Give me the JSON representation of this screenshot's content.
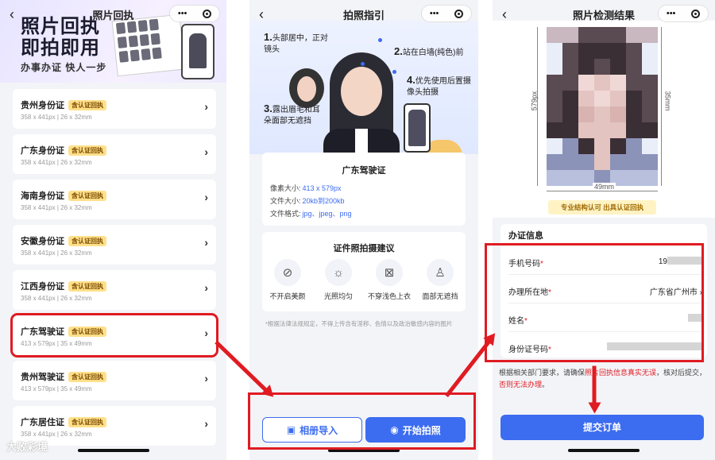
{
  "colors": {
    "accent": "#3c6cf0",
    "highlight": "#e01b22",
    "tag_bg": "#ffe08a"
  },
  "panel1": {
    "title": "照片回执",
    "banner": {
      "line1": "照片回执",
      "line2": "即拍即用",
      "subtitle": "办事办证 快人一步"
    },
    "tag_label": "含认证回执",
    "items": [
      {
        "name": "贵州身份证",
        "spec": "358 x 441px | 26 x 32mm"
      },
      {
        "name": "广东身份证",
        "spec": "358 x 441px | 26 x 32mm"
      },
      {
        "name": "海南身份证",
        "spec": "358 x 441px | 26 x 32mm"
      },
      {
        "name": "安徽身份证",
        "spec": "358 x 441px | 26 x 32mm"
      },
      {
        "name": "江西身份证",
        "spec": "358 x 441px | 26 x 32mm"
      },
      {
        "name": "广东驾驶证",
        "spec": "413 x 579px | 35 x 49mm",
        "highlighted": true
      },
      {
        "name": "贵州驾驶证",
        "spec": "413 x 579px | 35 x 49mm"
      },
      {
        "name": "广东居住证",
        "spec": "358 x 441px | 26 x 32mm"
      }
    ]
  },
  "panel2": {
    "title": "拍照指引",
    "tips": {
      "t1_num": "1.",
      "t1": "头部居中，正对镜头",
      "t2_num": "2.",
      "t2": "站在白墙(纯色)前",
      "t3_num": "3.",
      "t3": "露出眉毛和耳朵面部无遮挡",
      "t4_num": "4.",
      "t4": "优先使用后置摄像头拍摄"
    },
    "info": {
      "heading": "广东驾驶证",
      "pixel_label": "像素大小:",
      "pixel": "413 x 579px",
      "size_label": "文件大小:",
      "size": "20kb到200kb",
      "format_label": "文件格式:",
      "format": "jpg、jpeg、png"
    },
    "advice": {
      "heading": "证件照拍摄建议",
      "items": [
        {
          "icon": "no-beauty-icon",
          "label": "不开启美颜"
        },
        {
          "icon": "light-icon",
          "label": "光照均匀"
        },
        {
          "icon": "shirt-icon",
          "label": "不穿浅色上衣"
        },
        {
          "icon": "person-icon",
          "label": "面部无遮挡"
        }
      ]
    },
    "note": "*根据法律法规规定，不得上传含有淫秽、色情以及政治敏感内容的图片",
    "album_button": "相册导入",
    "shoot_button": "开始拍照"
  },
  "panel3": {
    "title": "照片检测结果",
    "dim_height_px": "579px",
    "dim_height_mm": "35mm",
    "dim_width_mm": "49mm",
    "cert_badge": "专业结构认可 出具认证回执",
    "office_heading": "办证信息",
    "fields": [
      {
        "label": "手机号码",
        "value": "19"
      },
      {
        "label": "办理所在地",
        "value": "广东省广州市 ›"
      },
      {
        "label": "姓名",
        "value": ""
      },
      {
        "label": "身份证号码",
        "value": ""
      }
    ],
    "hint_pre": "根据相关部门要求，请确保",
    "hint_red1": "照片回执信息真实无误",
    "hint_mid": "，核对后提交，",
    "hint_red2": "否则无法办理",
    "hint_end": "。",
    "submit_button": "提交订单"
  },
  "watermark": "大败彩境"
}
